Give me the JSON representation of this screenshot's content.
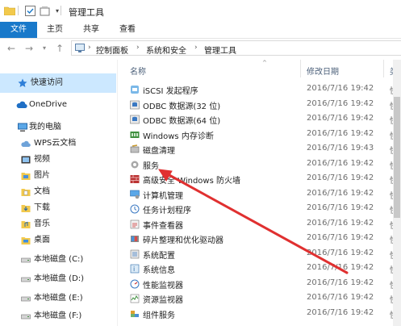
{
  "window": {
    "title": "管理工具"
  },
  "ribbon": {
    "tabs": [
      "文件",
      "主页",
      "共享",
      "查看"
    ]
  },
  "address": {
    "crumbs": [
      "控制面板",
      "系统和安全",
      "管理工具"
    ]
  },
  "nav": {
    "items": [
      {
        "label": "快速访问",
        "icon": "star-icon"
      },
      {
        "label": "OneDrive",
        "icon": "cloud-icon"
      },
      {
        "label": "我的电脑",
        "icon": "computer-icon"
      },
      {
        "label": "WPS云文档",
        "icon": "cloud-doc-icon"
      },
      {
        "label": "视频",
        "icon": "video-folder-icon"
      },
      {
        "label": "图片",
        "icon": "picture-folder-icon"
      },
      {
        "label": "文档",
        "icon": "document-folder-icon"
      },
      {
        "label": "下载",
        "icon": "download-folder-icon"
      },
      {
        "label": "音乐",
        "icon": "music-folder-icon"
      },
      {
        "label": "桌面",
        "icon": "desktop-folder-icon"
      },
      {
        "label": "本地磁盘 (C:)",
        "icon": "drive-icon"
      },
      {
        "label": "本地磁盘 (D:)",
        "icon": "drive-icon"
      },
      {
        "label": "本地磁盘 (E:)",
        "icon": "drive-icon"
      },
      {
        "label": "本地磁盘 (F:)",
        "icon": "drive-icon"
      }
    ]
  },
  "list": {
    "columns": {
      "name": "名称",
      "date": "修改日期",
      "type": "类"
    },
    "files": [
      {
        "name": "iSCSI 发起程序",
        "date": "2016/7/16 19:42",
        "type": "快"
      },
      {
        "name": "ODBC 数据源(32 位)",
        "date": "2016/7/16 19:42",
        "type": "快"
      },
      {
        "name": "ODBC 数据源(64 位)",
        "date": "2016/7/16 19:42",
        "type": "快"
      },
      {
        "name": "Windows 内存诊断",
        "date": "2016/7/16 19:42",
        "type": "快"
      },
      {
        "name": "磁盘清理",
        "date": "2016/7/16 19:43",
        "type": "快"
      },
      {
        "name": "服务",
        "date": "2016/7/16 19:42",
        "type": "快"
      },
      {
        "name": "高级安全 Windows 防火墙",
        "date": "2016/7/16 19:42",
        "type": "快"
      },
      {
        "name": "计算机管理",
        "date": "2016/7/16 19:42",
        "type": "快"
      },
      {
        "name": "任务计划程序",
        "date": "2016/7/16 19:42",
        "type": "快"
      },
      {
        "name": "事件查看器",
        "date": "2016/7/16 19:42",
        "type": "快"
      },
      {
        "name": "碎片整理和优化驱动器",
        "date": "2016/7/16 19:42",
        "type": "快"
      },
      {
        "name": "系统配置",
        "date": "2016/7/16 19:42",
        "type": "快"
      },
      {
        "name": "系统信息",
        "date": "2016/7/16 19:42",
        "type": "快"
      },
      {
        "name": "性能监视器",
        "date": "2016/7/16 19:42",
        "type": "快"
      },
      {
        "name": "资源监视器",
        "date": "2016/7/16 19:42",
        "type": "快"
      },
      {
        "name": "组件服务",
        "date": "2016/7/16 19:42",
        "type": "快"
      }
    ]
  },
  "annotation": {
    "arrow_color": "#e03030"
  },
  "colors": {
    "accent": "#1979ca",
    "selected": "#cce8ff"
  }
}
